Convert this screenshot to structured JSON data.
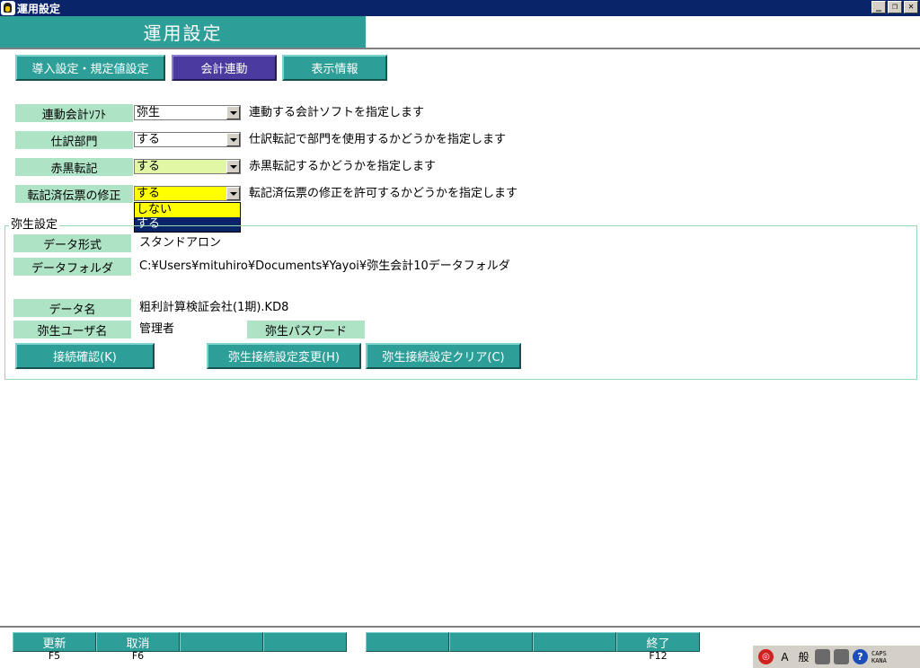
{
  "window": {
    "title": "運用設定",
    "minimize": "_",
    "restore": "❐",
    "close": "✕"
  },
  "header": {
    "title": "運用設定"
  },
  "tabs": [
    {
      "label": "導入設定・規定値設定"
    },
    {
      "label": "会計連動"
    },
    {
      "label": "表示情報"
    }
  ],
  "settings": [
    {
      "label": "連動会計ｿﾌﾄ",
      "value": "弥生",
      "desc": "連動する会計ソフトを指定します",
      "color": "#ffffff"
    },
    {
      "label": "仕訳部門",
      "value": "する",
      "desc": "仕訳転記で部門を使用するかどうかを指定します",
      "color": "#ffffff"
    },
    {
      "label": "赤黒転記",
      "value": "する",
      "desc": "赤黒転記するかどうかを指定します",
      "color": "#e2f7a6"
    },
    {
      "label": "転記済伝票の修正",
      "value": "する",
      "desc": "転記済伝票の修正を許可するかどうかを指定します",
      "color": "#ffff00"
    }
  ],
  "dropdown": {
    "options": [
      "しない",
      "する"
    ],
    "selected": "する"
  },
  "yayoi": {
    "group_title": "弥生設定",
    "format_label": "データ形式",
    "format_value": "スタンドアロン",
    "folder_label": "データフォルダ",
    "folder_value": "C:¥Users¥mituhiro¥Documents¥Yayoi¥弥生会計10データフォルダ",
    "name_label": "データ名",
    "name_value": "粗利計算検証会社(1期).KD8",
    "user_label": "弥生ユーザ名",
    "user_value": "管理者",
    "password_label": "弥生パスワード",
    "btn_check": "接続確認(K)",
    "btn_change": "弥生接続設定変更(H)",
    "btn_clear": "弥生接続設定クリア(C)"
  },
  "fkeys": [
    {
      "label": "更新",
      "key": "F5"
    },
    {
      "label": "取消",
      "key": "F6"
    },
    {
      "label": "",
      "key": ""
    },
    {
      "label": "",
      "key": ""
    },
    {
      "label": "",
      "key": ""
    },
    {
      "label": "",
      "key": ""
    },
    {
      "label": "",
      "key": ""
    },
    {
      "label": "終了",
      "key": "F12"
    }
  ],
  "ime": {
    "mode": "A",
    "kanji": "般",
    "caps": "CAPS",
    "kana": "KANA"
  },
  "colors": {
    "teal": "#2e9e98",
    "active_tab": "#4b3aa0",
    "label_green": "#aee3c6"
  }
}
